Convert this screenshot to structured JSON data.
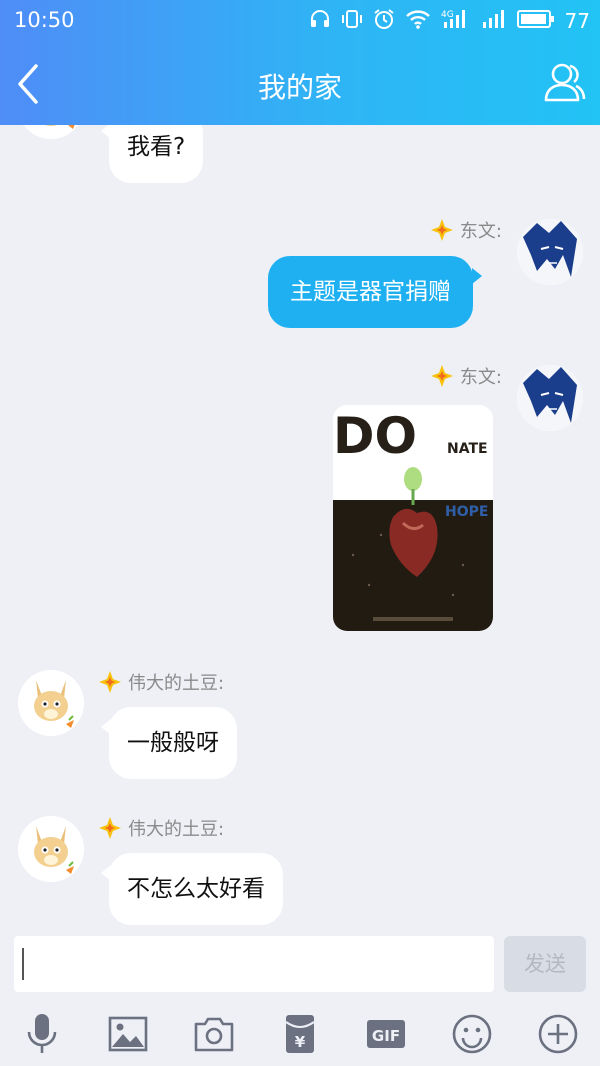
{
  "status": {
    "time": "10:50",
    "battery": "77",
    "network": "4G"
  },
  "nav": {
    "title": "我的家"
  },
  "messages": [
    {
      "side": "left",
      "text": "我看?"
    },
    {
      "side": "right",
      "sender": "东文:",
      "text": "主题是器官捐赠"
    },
    {
      "side": "right",
      "sender": "东文:",
      "image": {
        "line1": "DO",
        "line2": "NATE",
        "line3": "HOPE"
      }
    },
    {
      "side": "left",
      "sender": "伟大的土豆:",
      "text": "一般般呀"
    },
    {
      "side": "left",
      "sender": "伟大的土豆:",
      "text": "不怎么太好看"
    }
  ],
  "input": {
    "value": "",
    "send_label": "发送"
  },
  "toolbar": {
    "gif_label": "GIF",
    "yen_label": "¥"
  },
  "colors": {
    "header_start": "#4f8df7",
    "header_end": "#22c3f5",
    "bubble_right": "#1fb0f2",
    "background": "#eef0f6"
  }
}
